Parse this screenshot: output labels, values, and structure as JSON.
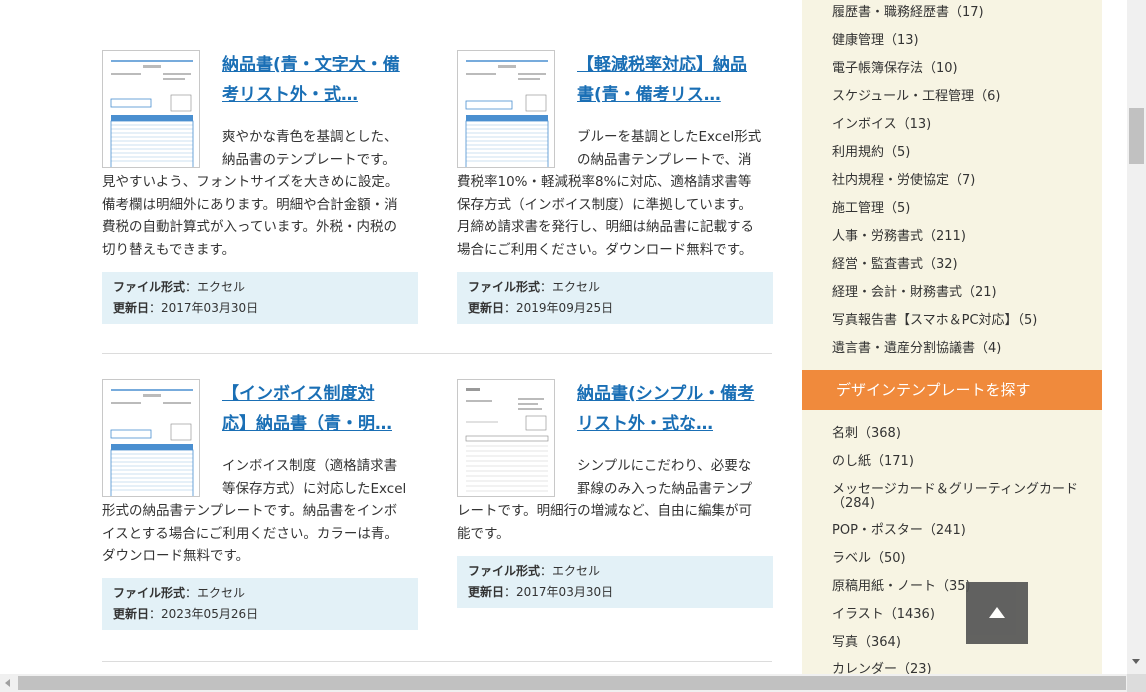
{
  "cards": [
    {
      "title_lines": [
        "納品書(青・文字大・備",
        "考リスト外・式…"
      ],
      "desc_lines": [
        "爽やかな青色を基調とした、",
        "納品書のテンプレートです。",
        "見やすいよう、フォントサイズを大きめに設定。",
        "備考欄は明細外にあります。明細や合計金額・消",
        "費税の自動計算式が入っています。外税・内税の",
        "切り替えもできます。"
      ],
      "format_label": "ファイル形式",
      "format_value": "：エクセル",
      "updated_label": "更新日",
      "updated_value": "：2017年03月30日"
    },
    {
      "title_lines": [
        "【軽減税率対応】納品",
        "書(青・備考リス…"
      ],
      "desc_lines": [
        "ブルーを基調としたExcel形式",
        "の納品書テンプレートで、消",
        "費税率10%・軽減税率8%に対応、適格請求書等",
        "保存方式（インボイス制度）に準拠しています。",
        "月締め請求書を発行し、明細は納品書に記載する",
        "場合にご利用ください。ダウンロード無料です。"
      ],
      "format_label": "ファイル形式",
      "format_value": "：エクセル",
      "updated_label": "更新日",
      "updated_value": "：2019年09月25日"
    },
    {
      "title_lines": [
        "【インボイス制度対",
        "応】納品書（青・明…"
      ],
      "desc_lines": [
        "インボイス制度（適格請求書",
        "等保存方式）に対応したExcel",
        "形式の納品書テンプレートです。納品書をインボ",
        "イスとする場合にご利用ください。カラーは青。",
        "ダウンロード無料です。"
      ],
      "format_label": "ファイル形式",
      "format_value": "：エクセル",
      "updated_label": "更新日",
      "updated_value": "：2023年05月26日"
    },
    {
      "title_lines": [
        "納品書(シンプル・備考",
        "リスト外・式な…"
      ],
      "desc_lines": [
        "シンプルにこだわり、必要な",
        "罫線のみ入った納品書テンプ",
        "レートです。明細行の増減など、自由に編集が可",
        "能です。"
      ],
      "format_label": "ファイル形式",
      "format_value": "：エクセル",
      "updated_label": "更新日",
      "updated_value": "：2017年03月30日"
    }
  ],
  "sidebar": {
    "categories": [
      "履歴書・職務経歴書（17)",
      "健康管理（13)",
      "電子帳簿保存法（10)",
      "スケジュール・工程管理（6)",
      "インボイス（13)",
      "利用規約（5)",
      "社内規程・労使協定（7)",
      "施工管理（5)",
      "人事・労務書式（211)",
      "経営・監査書式（32)",
      "経理・会計・財務書式（21)",
      "写真報告書【スマホ＆PC対応】（5)",
      "遺言書・遺産分割協議書（4)"
    ],
    "design_header": "デザインテンプレートを探す",
    "design_items": [
      "名刺（368)",
      "のし紙（171)",
      "メッセージカード＆グリーティングカード",
      "（284)",
      "POP・ポスター（241)",
      "ラベル（50)",
      "原稿用紙・ノート（35)",
      "イラスト（1436)",
      "写真（364)",
      "カレンダー（23)"
    ]
  },
  "colors": {
    "accent_orange": "#f08a3c",
    "link_blue": "#1a6fb5",
    "meta_bg": "#e3f1f7",
    "sidebar_bg": "#f7f4e3"
  },
  "icons": {
    "scroll_top": "triangle-up-icon"
  }
}
